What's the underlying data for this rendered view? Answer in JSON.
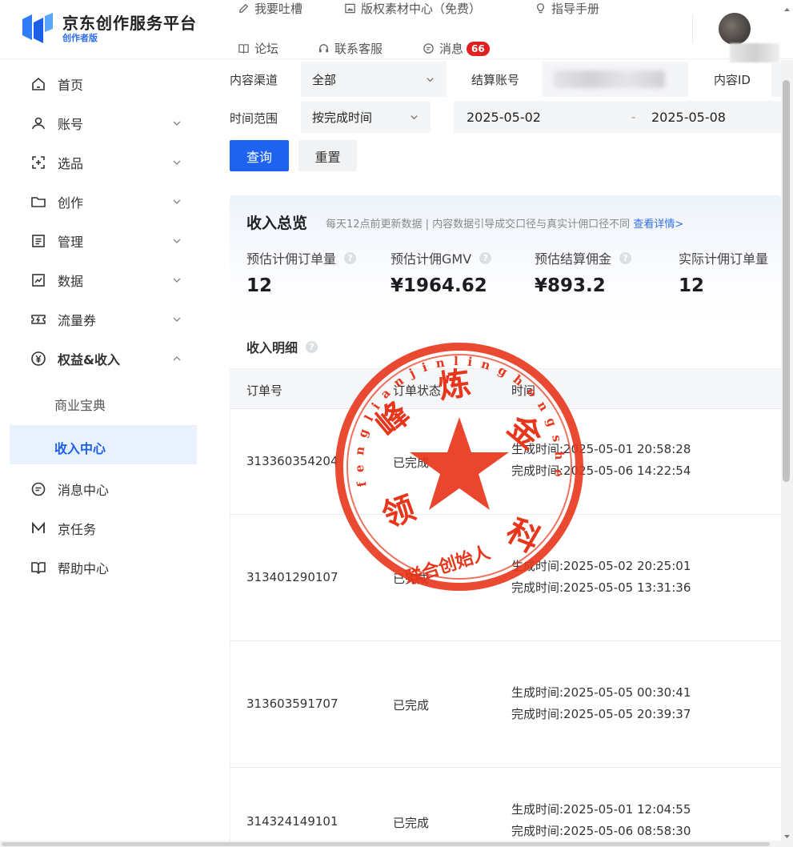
{
  "brand": {
    "title": "京东创作服务平台",
    "subtitle": "创作者版",
    "colors": {
      "primary": "#1e63f0",
      "active_bg": "#e9f1fe",
      "badge": "#e02020",
      "seal": "#e8361c"
    }
  },
  "header": {
    "links": [
      {
        "label": "我要吐槽",
        "icon": "pencil-icon"
      },
      {
        "label": "版权素材中心（免费）",
        "icon": "image-icon"
      },
      {
        "label": "指导手册",
        "icon": "lightbulb-icon"
      },
      {
        "label": "论坛",
        "icon": "book-icon"
      },
      {
        "label": "联系客服",
        "icon": "headset-icon"
      },
      {
        "label": "消息",
        "icon": "chat-icon",
        "badge": "66"
      }
    ]
  },
  "sidebar": {
    "items": [
      {
        "label": "首页",
        "icon": "home-icon"
      },
      {
        "label": "账号",
        "icon": "user-icon"
      },
      {
        "label": "选品",
        "icon": "scan-plus-icon"
      },
      {
        "label": "创作",
        "icon": "folder-icon"
      },
      {
        "label": "管理",
        "icon": "list-icon"
      },
      {
        "label": "数据",
        "icon": "chart-icon"
      },
      {
        "label": "流量券",
        "icon": "coupon-icon"
      },
      {
        "label": "权益&收入",
        "icon": "yen-icon"
      }
    ],
    "sub_items": [
      {
        "label": "商业宝典"
      },
      {
        "label": "收入中心"
      }
    ],
    "bottom_items": [
      {
        "label": "消息中心",
        "icon": "message-icon"
      },
      {
        "label": "京任务",
        "icon": "m-icon"
      },
      {
        "label": "帮助中心",
        "icon": "open-book-icon"
      }
    ]
  },
  "filters": {
    "channel_label": "内容渠道",
    "channel_value": "全部",
    "account_label": "结算账号",
    "content_id_label": "内容ID",
    "time_range_label": "时间范围",
    "time_type_value": "按完成时间",
    "date_start": "2025-05-02",
    "date_sep": "-",
    "date_end": "2025-05-08",
    "query_button": "查询",
    "reset_button": "重置"
  },
  "overview": {
    "title": "收入总览",
    "note": "每天12点前更新数据 | 内容数据引导成交口径与真实计佣口径不同",
    "link": "查看详情>",
    "metrics": [
      {
        "label": "预估计佣订单量",
        "value": "12"
      },
      {
        "label": "预估计佣GMV",
        "value": "¥1964.62"
      },
      {
        "label": "预估结算佣金",
        "value": "¥893.2"
      },
      {
        "label": "实际计佣订单量",
        "value": "12"
      }
    ]
  },
  "detail": {
    "title": "收入明细",
    "columns": [
      "订单号",
      "订单状态",
      "时间"
    ],
    "rows": [
      {
        "order_id": "313360354204",
        "status": "已完成",
        "created": "生成时间:2025-05-01 20:58:28",
        "completed": "完成时间:2025-05-06 14:22:54"
      },
      {
        "order_id": "313401290107",
        "status": "已完成",
        "created": "生成时间:2025-05-02 20:25:01",
        "completed": "完成时间:2025-05-05 13:31:36"
      },
      {
        "order_id": "313603591707",
        "status": "已完成",
        "created": "生成时间:2025-05-05 00:30:41",
        "completed": "完成时间:2025-05-05 20:39:37"
      },
      {
        "order_id": "314324149101",
        "status": "已完成",
        "created": "生成时间:2025-05-01 12:04:55",
        "completed": "完成时间:2025-05-06 08:58:30"
      }
    ]
  },
  "seal": {
    "center_chars": [
      "峰",
      "炼",
      "金",
      "领",
      "科"
    ],
    "ring_latin": "fenglianjinlinghongshe",
    "bottom_text": "联合创始人"
  }
}
